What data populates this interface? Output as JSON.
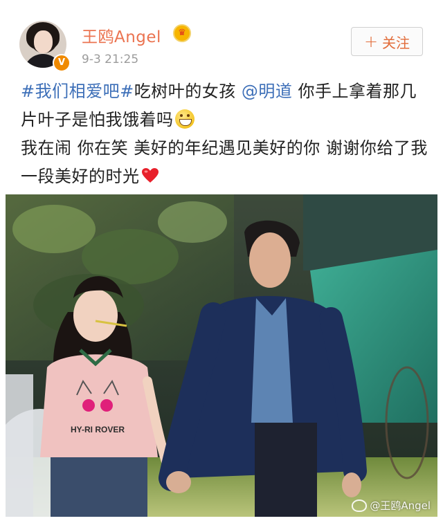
{
  "post": {
    "username": "王鸥Angel",
    "timestamp": "9-3 21:25",
    "follow_label": "关注",
    "follow_icon": "plus-icon",
    "verified_icon": "verified-v-icon",
    "member_icon": "crown-icon",
    "text": {
      "hashtag": "#我们相爱吧#",
      "part1": "吃树叶的女孩 ",
      "mention": "@明道",
      "part2": " 你手上拿着那几片叶子是怕我饿着吗",
      "emoji1": "grinning-emoji-icon",
      "part3": "我在闹 你在笑 美好的年纪遇见美好的你 谢谢你给了我一段美好的时光",
      "emoji2": "red-heart-icon"
    }
  },
  "photo": {
    "shirt_print": "HY-RI ROVER",
    "watermark": "@王鸥Angel",
    "watermark_icon": "weibo-logo-icon"
  },
  "colors": {
    "username": "#eb7350",
    "link": "#3d6fb8",
    "follow": "#e26c3a",
    "timestamp": "#9b9b9b"
  }
}
